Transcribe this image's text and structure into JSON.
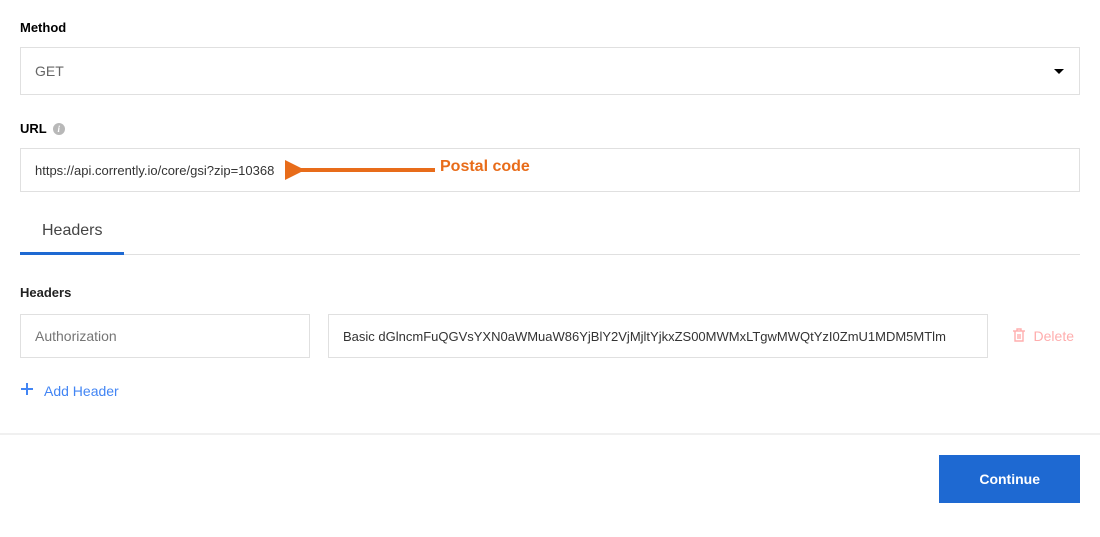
{
  "method": {
    "label": "Method",
    "value": "GET"
  },
  "url": {
    "label": "URL",
    "value": "https://api.corrently.io/core/gsi?zip=10368"
  },
  "tabs": {
    "headers": "Headers"
  },
  "headersSection": {
    "label": "Headers",
    "row": {
      "keyPlaceholder": "Authorization",
      "value": "Basic dGlncmFuQGVsYXN0aWMuaW86YjBlY2VjMjltYjkxZS00MWMxLTgwMWQtYzI0ZmU1MDM5MTlm"
    },
    "delete": "Delete",
    "add": "Add Header"
  },
  "footer": {
    "continue": "Continue"
  },
  "annotation": {
    "label": "Postal code"
  }
}
